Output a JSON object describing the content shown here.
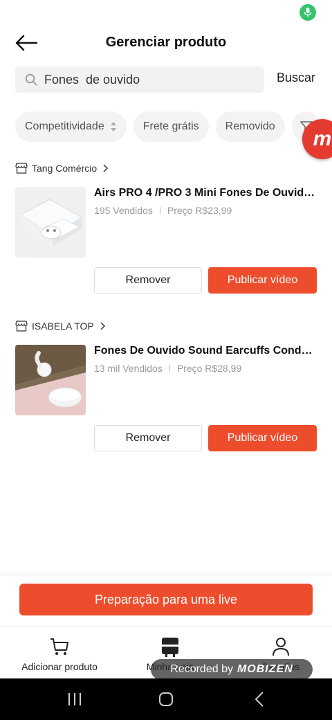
{
  "header": {
    "title": "Gerenciar produto"
  },
  "search": {
    "value": "Fones  de ouvido",
    "button_label": "Buscar"
  },
  "filters": [
    "Competitividade",
    "Frete grátis",
    "Removido"
  ],
  "overlay_badge": "m",
  "products": [
    {
      "store": "Tang Comércio",
      "title": "Airs PRO 4 /PRO 3 Mini Fones De Ouvido...",
      "sold": "195 Vendidos",
      "price": "Preço R$23,99",
      "remove_label": "Remover",
      "publish_label": "Publicar vídeo"
    },
    {
      "store": "ISABELA TOP",
      "title": "Fones De Ouvido Sound Earcuffs Conduçã...",
      "sold": "13 mil Vendidos",
      "price": "Preço R$28,99",
      "remove_label": "Remover",
      "publish_label": "Publicar vídeo"
    }
  ],
  "live_button": "Preparação para uma live",
  "tabs": [
    {
      "label": "Adicionar produto",
      "icon": "cart-icon"
    },
    {
      "label": "Minha Loja",
      "icon": "store-icon"
    },
    {
      "label": "Desafios",
      "icon": "profile-icon"
    }
  ],
  "recording_overlay": {
    "text": "Recorded by",
    "brand": "MOBIZEN"
  },
  "colors": {
    "accent": "#ee4d2d",
    "mic": "#34c46a",
    "badge": "#e43a2f"
  }
}
